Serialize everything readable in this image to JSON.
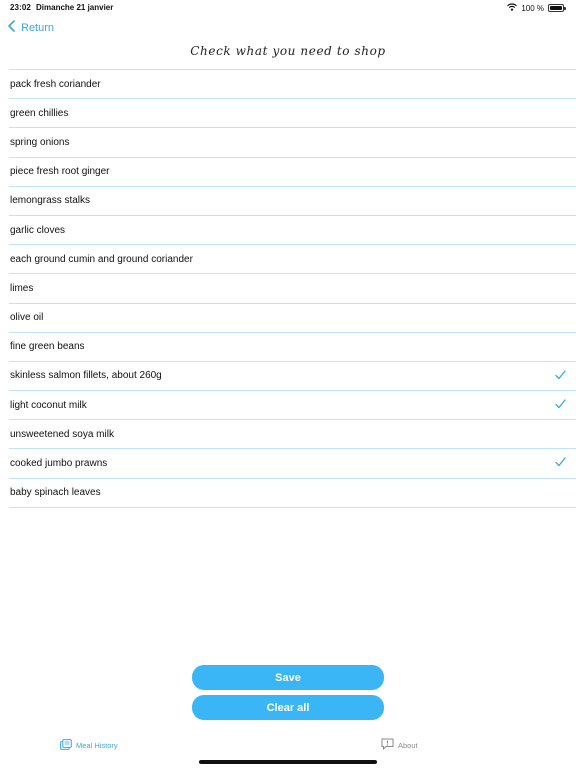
{
  "status_bar": {
    "time": "23:02",
    "date": "Dimanche 21 janvier",
    "battery": "100 %"
  },
  "nav": {
    "back_label": "Return"
  },
  "title": "Check what you need to shop",
  "items": [
    {
      "label": "pack fresh coriander",
      "checked": false
    },
    {
      "label": "green chillies",
      "checked": false
    },
    {
      "label": "spring onions",
      "checked": false
    },
    {
      "label": "piece fresh root ginger",
      "checked": false
    },
    {
      "label": "lemongrass stalks",
      "checked": false
    },
    {
      "label": "garlic cloves",
      "checked": false
    },
    {
      "label": "each ground cumin and ground coriander",
      "checked": false
    },
    {
      "label": "limes",
      "checked": false
    },
    {
      "label": "olive oil",
      "checked": false
    },
    {
      "label": "fine green beans",
      "checked": false
    },
    {
      "label": "skinless salmon fillets, about 260g",
      "checked": true
    },
    {
      "label": "light coconut milk",
      "checked": true
    },
    {
      "label": "unsweetened soya milk",
      "checked": false
    },
    {
      "label": "cooked jumbo prawns",
      "checked": true
    },
    {
      "label": "baby spinach leaves",
      "checked": false
    }
  ],
  "buttons": {
    "save_label": "Save",
    "clear_label": "Clear all"
  },
  "tabs": [
    {
      "label": "Meal History",
      "active": true,
      "icon": "meal-history-icon"
    },
    {
      "label": "About",
      "active": false,
      "icon": "about-icon"
    }
  ],
  "colors": {
    "accent": "#3ab6f7",
    "link": "#3ea6de",
    "divider": "#bfe3f4"
  }
}
